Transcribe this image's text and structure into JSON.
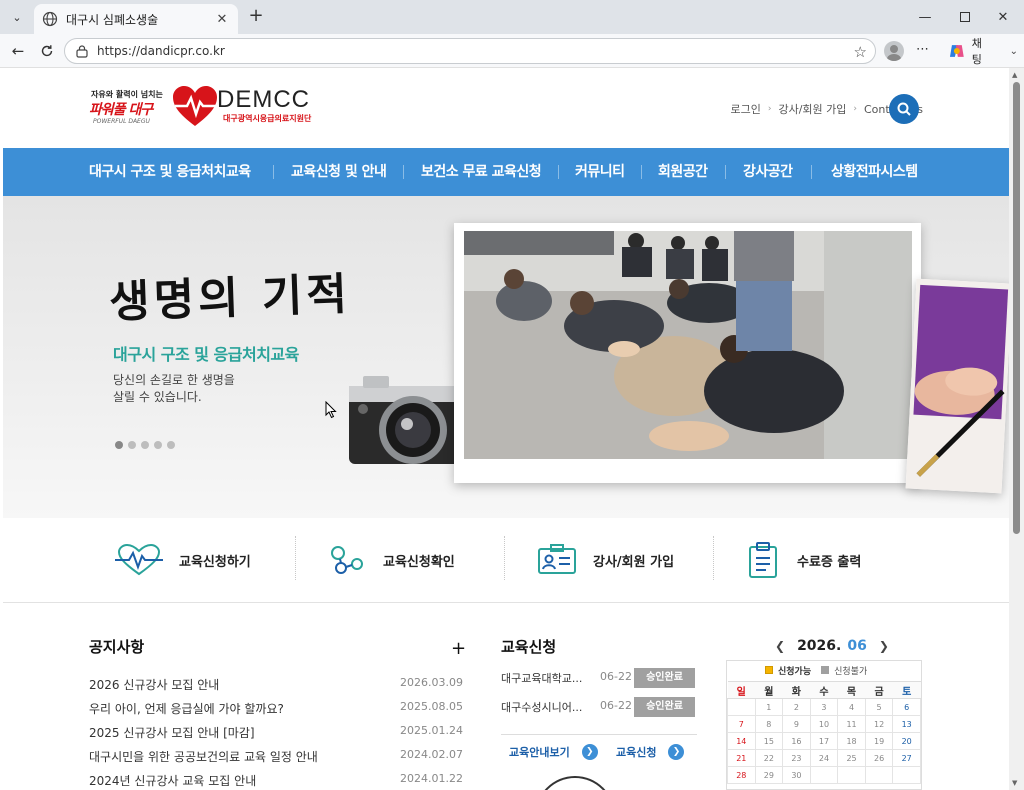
{
  "browser": {
    "tab_title": "대구시 심폐소생술",
    "url": "https://dandicpr.co.kr",
    "chat_label": "채팅"
  },
  "header": {
    "slogan_small": "자유와 활력이 넘치는",
    "slogan_big": "파워풀 대구",
    "slogan_eng": "POWERFUL DAEGU",
    "logo_word": "DEMCC",
    "logo_sub": "대구광역시응급의료지원단",
    "util": [
      "로그인",
      "강사/회원 가입",
      "Contact us"
    ]
  },
  "nav": [
    "대구시 구조 및 응급처치교육",
    "교육신청 및 안내",
    "보건소 무료 교육신청",
    "커뮤니티",
    "회원공간",
    "강사공간",
    "상황전파시스템"
  ],
  "hero": {
    "title": "생명의 기적",
    "subtitle": "대구시 구조 및 응급처치교육",
    "desc1": "당신의 손길로 한 생명을",
    "desc2": "살릴 수 있습니다.",
    "slides": 5,
    "active_slide": 1
  },
  "quick": [
    "교육신청하기",
    "교육신청확인",
    "강사/회원 가입",
    "수료증 출력"
  ],
  "notice": {
    "title": "공지사항",
    "more": "+",
    "items": [
      {
        "title": "2026 신규강사 모집 안내",
        "date": "2026.03.09"
      },
      {
        "title": "우리 아이, 언제 응급실에 가야 할까요?",
        "date": "2025.08.05"
      },
      {
        "title": "2025 신규강사 모집 안내 [마감]",
        "date": "2025.01.24"
      },
      {
        "title": "대구시민을 위한 공공보건의료 교육 일정 안내",
        "date": "2024.02.07"
      },
      {
        "title": "2024년 신규강사 교육 모집 안내",
        "date": "2024.01.22"
      }
    ]
  },
  "education": {
    "title": "교육신청",
    "items": [
      {
        "title": "대구교육대학교...",
        "date": "06-22",
        "status": "승인완료"
      },
      {
        "title": "대구수성시니어...",
        "date": "06-22",
        "status": "승인완료"
      }
    ],
    "link_guide": "교육안내보기",
    "link_apply": "교육신청"
  },
  "calendar": {
    "year": "2026.",
    "month": "06",
    "legend_on": "신청가능",
    "legend_off": "신청불가",
    "weekdays": [
      "일",
      "월",
      "화",
      "수",
      "목",
      "금",
      "토"
    ],
    "weeks": [
      [
        "",
        "1",
        "2",
        "3",
        "4",
        "5",
        "6"
      ],
      [
        "7",
        "8",
        "9",
        "10",
        "11",
        "12",
        "13"
      ],
      [
        "14",
        "15",
        "16",
        "17",
        "18",
        "19",
        "20"
      ],
      [
        "21",
        "22",
        "23",
        "24",
        "25",
        "26",
        "27"
      ],
      [
        "28",
        "29",
        "30",
        "",
        "",
        "",
        ""
      ]
    ]
  },
  "colors": {
    "nav_blue": "#3d8fd6",
    "brand_red": "#d7141a",
    "teal": "#2aa39a",
    "badge_gray": "#a0a0a0"
  }
}
